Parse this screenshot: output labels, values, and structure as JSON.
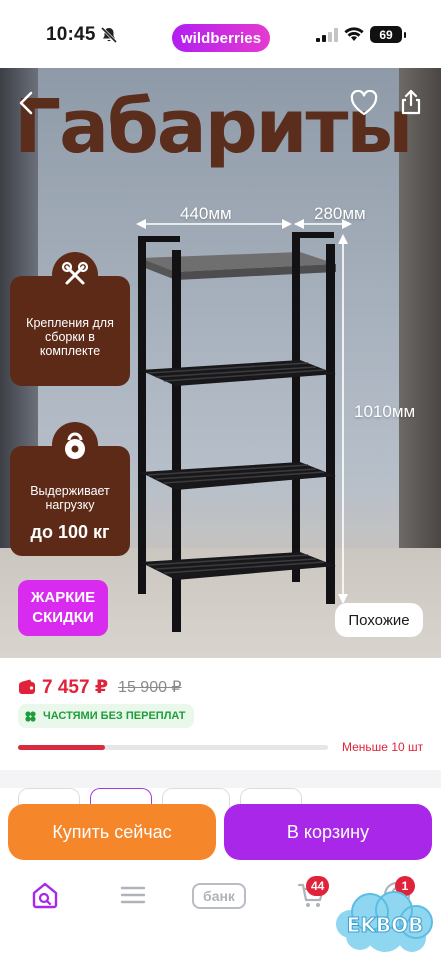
{
  "status_bar": {
    "time": "10:45",
    "battery": "69",
    "brand": "wildberries"
  },
  "hero": {
    "title": "Габариты",
    "dim_width": "440мм",
    "dim_depth": "280мм",
    "dim_height": "1010мм",
    "card_mount_text": "Крепления для сборки в комплекте",
    "card_load_text": "Выдерживает нагрузку",
    "card_load_value": "до 100 кг",
    "badge_line1": "ЖАРКИЕ",
    "badge_line2": "СКИДКИ",
    "similar_label": "Похожие"
  },
  "price": {
    "current": "7 457 ₽",
    "old": "15 900 ₽",
    "installment": "ЧАСТЯМИ БЕЗ ПЕРЕПЛАТ",
    "stock_label": "Меньше 10 шт",
    "stock_level": 0.28,
    "accent": "#e0223a"
  },
  "actions": {
    "buy_now": "Купить сейчас",
    "to_cart": "В корзину",
    "buy_color": "#f5872a",
    "cart_color": "#a927e8"
  },
  "tabbar": {
    "bank_label": "банк",
    "cart_badge": "44",
    "profile_badge": "1"
  },
  "watermark": "EKBOB"
}
